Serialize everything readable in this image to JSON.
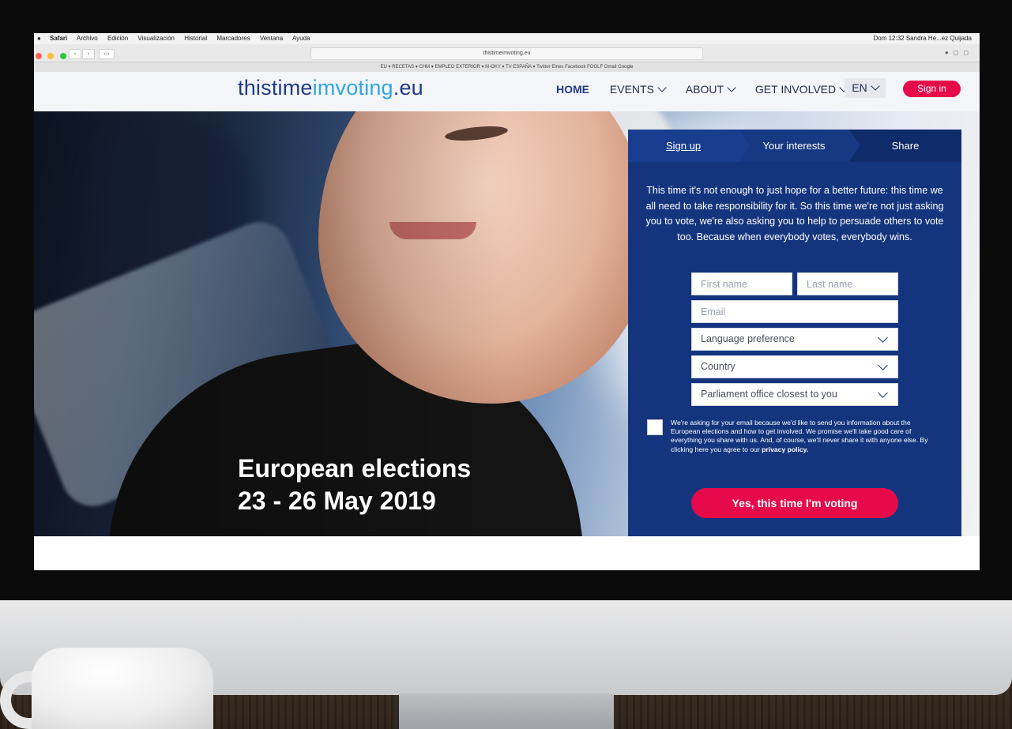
{
  "browser": {
    "menu": [
      "Safari",
      "Archivo",
      "Edición",
      "Visualización",
      "Historial",
      "Marcadores",
      "Ventana",
      "Ayuda"
    ],
    "status_right": "Dom 12:32   Sandra He...ez Quijada",
    "url": "thistimeimvoting.eu",
    "bookmarks": "EU ▾   RECETAS ▾   CHM ▾   EMPLEO EXTERIOR ▾   M-OKY ▾   TV ESPAÑA ▾   Twitter   Eines   Facebook   FOOLF   Gmail   Google"
  },
  "site": {
    "logo_part1": "thistime",
    "logo_part2": "imvoting",
    "logo_part3": ".eu",
    "nav": {
      "home": "HOME",
      "events": "EVENTS",
      "about": "ABOUT",
      "get_involved": "GET INVOLVED"
    },
    "lang": "EN",
    "signin": "Sign in"
  },
  "hero": {
    "line1": "European elections",
    "line2": "23 - 26 May 2019"
  },
  "form": {
    "tabs": [
      "Sign up",
      "Your interests",
      "Share"
    ],
    "intro": "This time it's not enough to just hope for a better future: this time we all need to take responsibility for it. So this time we're not just asking you to vote, we're also asking you to help to persuade others to vote too. Because when everybody votes, everybody wins.",
    "first_name": "First name",
    "last_name": "Last name",
    "email": "Email",
    "language": "Language preference",
    "country": "Country",
    "office": "Parliament office closest to you",
    "consent": "We're asking for your email because we'd like to send you information about the European elections and how to get involved. We promise we'll take good care of everything you share with us. And, of course, we'll never share it with anyone else. By clicking here you agree to our",
    "privacy": "privacy policy.",
    "cta": "Yes, this time I'm voting"
  },
  "colors": {
    "brand_blue": "#1f3a8a",
    "accent_cyan": "#2ea6df",
    "cta_pink": "#e60a4b",
    "panel_blue": "#14357e"
  }
}
